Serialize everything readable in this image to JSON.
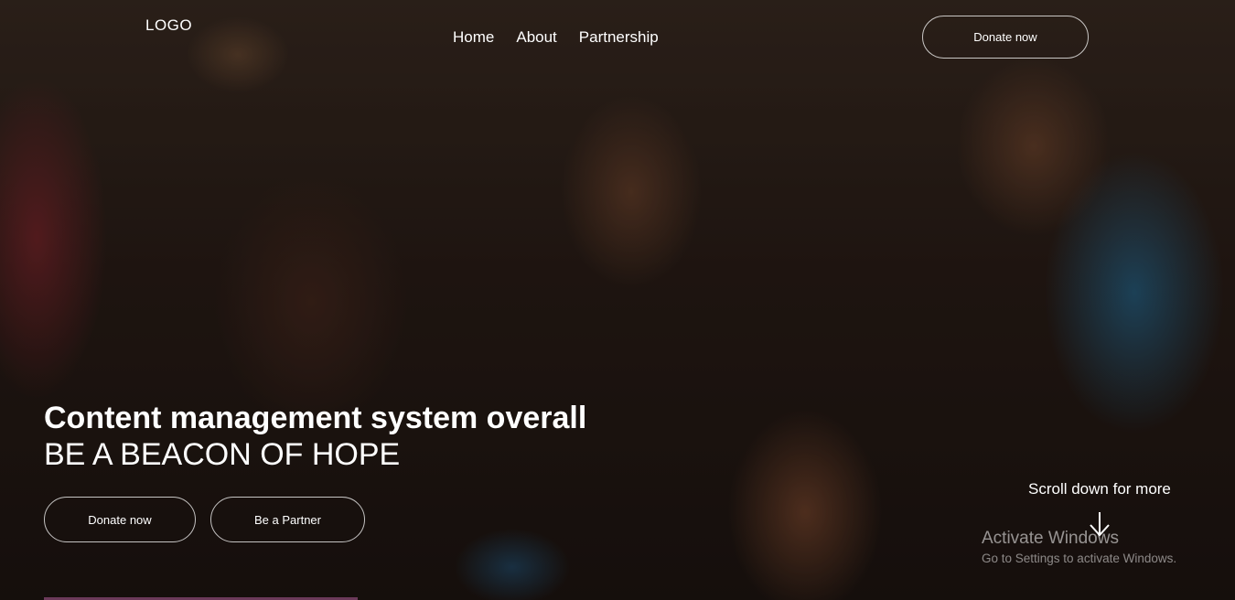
{
  "header": {
    "logo": "LOGO",
    "nav": {
      "home": "Home",
      "about": "About",
      "partnership": "Partnership"
    },
    "donate_label": "Donate now"
  },
  "hero": {
    "headline": "Content management system overall",
    "tagline": "BE A BEACON OF HOPE",
    "donate_label": "Donate now",
    "partner_label": "Be a Partner",
    "scroll_hint": "Scroll down for more",
    "scroll_icon": "arrow-down-icon",
    "background": "photo-smiling-children"
  },
  "system_watermark": {
    "title": "Activate Windows",
    "subtitle": "Go to Settings to activate Windows."
  },
  "colors": {
    "text": "#ffffff",
    "button_border": "#ffffff",
    "accent_bar": "#6b3a5a"
  }
}
